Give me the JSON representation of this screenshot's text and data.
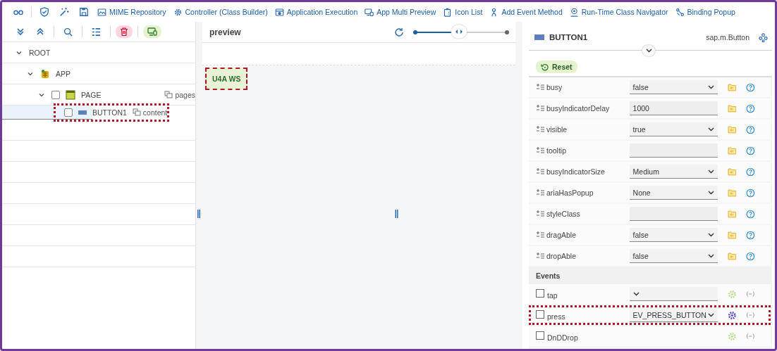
{
  "toolbar": {
    "links": [
      "MIME Repository",
      "Controller (Class Builder)",
      "Application Execution",
      "App Multi Preview",
      "Icon List",
      "Add Event Method",
      "Run-Time Class Navigator",
      "Binding Popup"
    ]
  },
  "tree": [
    {
      "label": "ROOT",
      "expanded": true,
      "children": [
        {
          "label": "APP",
          "expanded": true,
          "children": [
            {
              "label": "PAGE",
              "expanded": true,
              "checked": false,
              "selected": false,
              "highlighted": false,
              "aggregation": "pages",
              "children": [
                {
                  "label": "BUTTON1",
                  "checked": false,
                  "selected": true,
                  "highlighted": true,
                  "aggregation": "content"
                }
              ]
            }
          ]
        }
      ]
    }
  ],
  "preview": {
    "title": "preview",
    "zoom": {
      "level": 0.48
    },
    "button": {
      "label": "U4A WS",
      "highlighted": true
    }
  },
  "inspector": {
    "title": "BUTTON1",
    "class_name": "sap.m.Button",
    "reset_label": "Reset",
    "properties": [
      {
        "name": "busy",
        "kind": "select",
        "value": "false"
      },
      {
        "name": "busyIndicatorDelay",
        "kind": "input",
        "value": "1000"
      },
      {
        "name": "visible",
        "kind": "select",
        "value": "true"
      },
      {
        "name": "tooltip",
        "kind": "input"
      },
      {
        "name": "busyIndicatorSize",
        "kind": "select",
        "value": "Medium"
      },
      {
        "name": "ariaHasPopup",
        "kind": "select",
        "value": "None"
      },
      {
        "name": "styleClass",
        "kind": "input"
      },
      {
        "name": "dragAble",
        "kind": "select",
        "value": "false"
      },
      {
        "name": "dropAble",
        "kind": "select",
        "value": "false"
      }
    ],
    "events_title": "Events",
    "events": [
      {
        "name": "tap",
        "checked": false,
        "kind": "select",
        "handler_set": false,
        "highlighted": false
      },
      {
        "name": "press",
        "checked": false,
        "kind": "select",
        "value": "EV_PRESS_BUTTON",
        "handler_set": true,
        "highlighted": true
      },
      {
        "name": "DnDDrop",
        "checked": false,
        "kind": "none",
        "handler_set": false,
        "highlighted": false
      }
    ]
  }
}
